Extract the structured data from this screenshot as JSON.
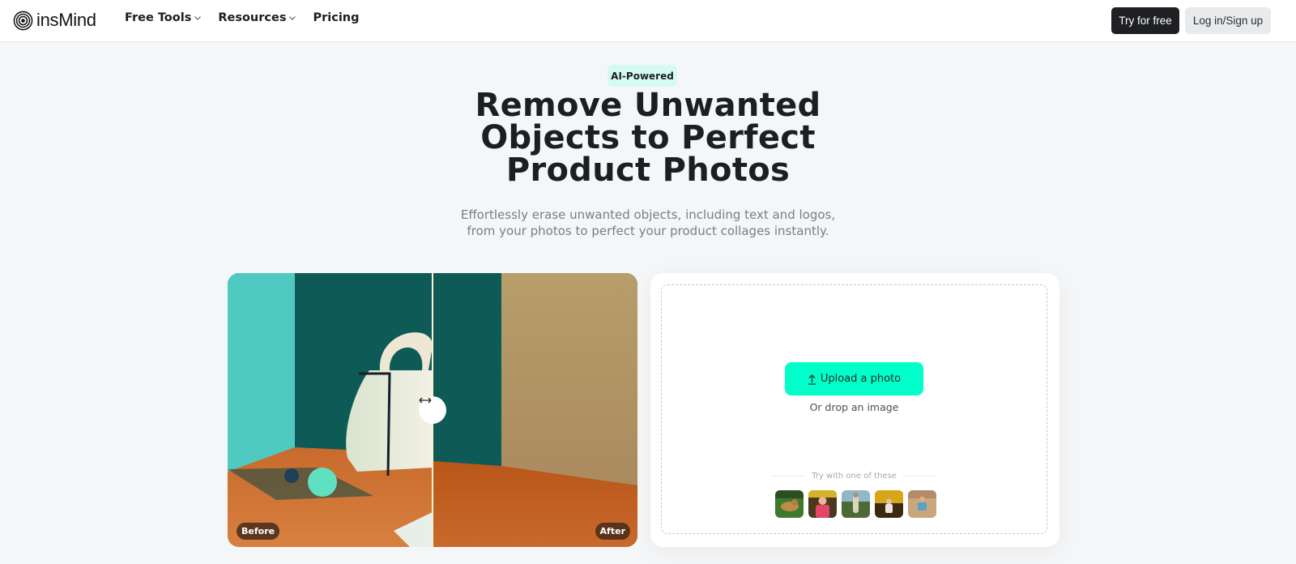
{
  "header": {
    "logo_text": "insMind",
    "nav": [
      {
        "label": "Free Tools",
        "has_dropdown": true
      },
      {
        "label": "Resources",
        "has_dropdown": true
      },
      {
        "label": "Pricing",
        "has_dropdown": false
      }
    ],
    "try_label": "Try for free",
    "login_label": "Log in/Sign up"
  },
  "hero": {
    "badge": "AI-Powered",
    "title_lines": [
      "Remove Unwanted",
      "Objects to Perfect",
      "Product Photos"
    ],
    "subtitle_lines": [
      "Effortlessly erase unwanted objects, including text and logos,",
      "from your photos to perfect your product collages instantly."
    ]
  },
  "compare": {
    "before_label": "Before",
    "after_label": "After",
    "handle_icon": "left-right-arrow-icon"
  },
  "upload": {
    "button_label": "Upload a photo",
    "button_icon": "upload-arrow-icon",
    "drop_text": "Or drop an image",
    "try_text": "Try with one of these",
    "samples": [
      {
        "name": "dog-on-grass"
      },
      {
        "name": "girl-in-pink-dress"
      },
      {
        "name": "woman-in-field"
      },
      {
        "name": "child-in-yellow-flowers"
      },
      {
        "name": "woman-on-beach"
      }
    ]
  },
  "colors": {
    "accent": "#00ffc9",
    "badge_bg": "#d5fbf1",
    "primary_dark": "#1f2023",
    "page_bg": "#f5f6f8"
  }
}
